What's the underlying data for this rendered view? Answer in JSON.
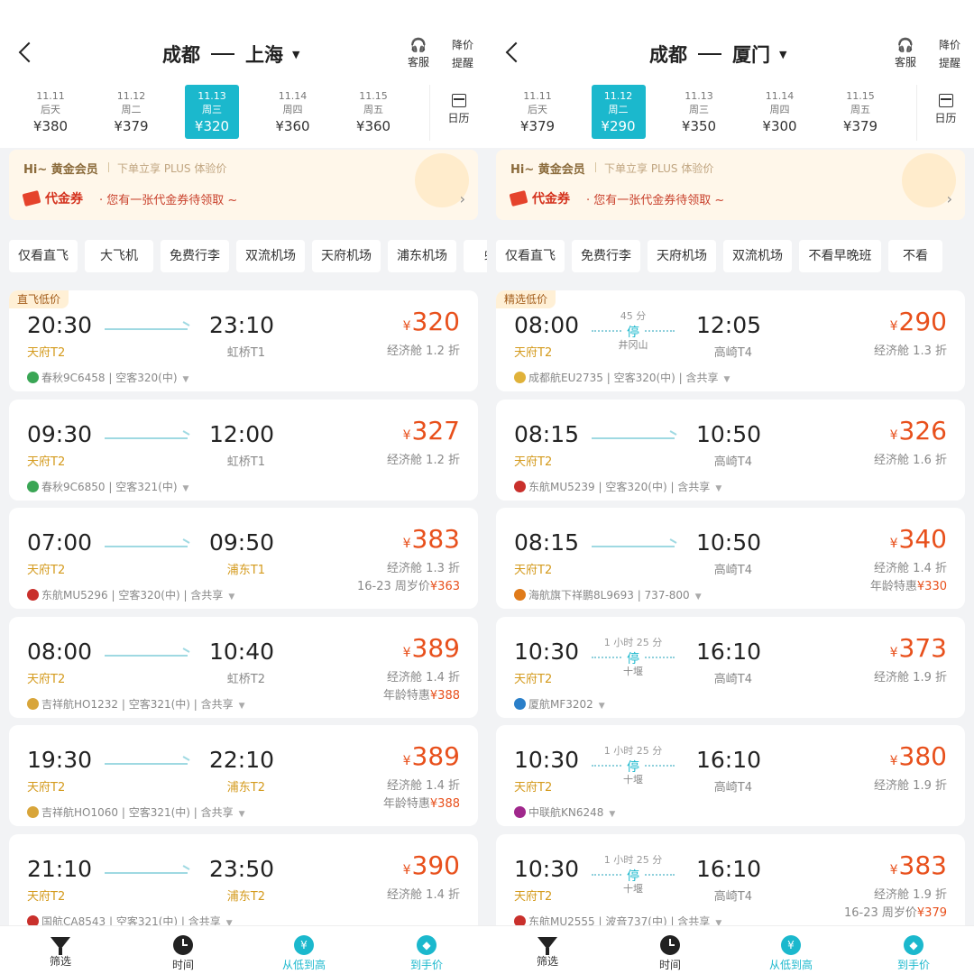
{
  "left": {
    "route": {
      "from": "成都",
      "to": "上海"
    },
    "header_btns": {
      "service": "客服",
      "alert_1": "降价",
      "alert_2": "提醒"
    },
    "dates": [
      {
        "date": "11.11",
        "day": "后天",
        "price": "¥380",
        "selected": false
      },
      {
        "date": "11.12",
        "day": "周二",
        "price": "¥379",
        "selected": false
      },
      {
        "date": "11.13",
        "day": "周三",
        "price": "¥320",
        "selected": true
      },
      {
        "date": "11.14",
        "day": "周四",
        "price": "¥360",
        "selected": false
      },
      {
        "date": "11.15",
        "day": "周五",
        "price": "¥360",
        "selected": false
      }
    ],
    "calendar": "日历",
    "promo": {
      "hi": "Hi~ 黄金会员",
      "sub": "下单立享 PLUS 体验价",
      "coupon_title": "代金券",
      "coupon_text": "· 您有一张代金券待领取 ~"
    },
    "chips": [
      "仅看直飞",
      "大飞机",
      "免费行李",
      "双流机场",
      "天府机场",
      "浦东机场",
      "虹"
    ],
    "flights": [
      {
        "tag": "直飞低价",
        "dep": "20:30",
        "dep_airport": "天府T2",
        "arr": "23:10",
        "arr_airport": "虹桥T1",
        "arr_hl": false,
        "price": "320",
        "cabin": "经济舱 1.2 折",
        "extra_label": "",
        "extra_value": "",
        "airline": "春秋9C6458",
        "meta": " | 空客320(中)",
        "logo_color": "#3aa655"
      },
      {
        "tag": "",
        "dep": "09:30",
        "dep_airport": "天府T2",
        "arr": "12:00",
        "arr_airport": "虹桥T1",
        "arr_hl": false,
        "price": "327",
        "cabin": "经济舱 1.2 折",
        "extra_label": "",
        "extra_value": "",
        "airline": "春秋9C6850",
        "meta": " | 空客321(中)",
        "logo_color": "#3aa655"
      },
      {
        "tag": "",
        "dep": "07:00",
        "dep_airport": "天府T2",
        "arr": "09:50",
        "arr_airport": "浦东T1",
        "arr_hl": true,
        "price": "383",
        "cabin": "经济舱 1.3 折",
        "extra_label": "16-23 周岁价",
        "extra_value": "¥363",
        "airline": "东航MU5296",
        "meta": " | 空客320(中) | 含共享",
        "logo_color": "#c9302c"
      },
      {
        "tag": "",
        "dep": "08:00",
        "dep_airport": "天府T2",
        "arr": "10:40",
        "arr_airport": "虹桥T2",
        "arr_hl": false,
        "price": "389",
        "cabin": "经济舱 1.4 折",
        "extra_label": "年龄特惠",
        "extra_value": "¥388",
        "airline": "吉祥航HO1232",
        "meta": " | 空客321(中) | 含共享",
        "logo_color": "#d8a53a"
      },
      {
        "tag": "",
        "dep": "19:30",
        "dep_airport": "天府T2",
        "arr": "22:10",
        "arr_airport": "浦东T2",
        "arr_hl": true,
        "price": "389",
        "cabin": "经济舱 1.4 折",
        "extra_label": "年龄特惠",
        "extra_value": "¥388",
        "airline": "吉祥航HO1060",
        "meta": " | 空客321(中) | 含共享",
        "logo_color": "#d8a53a"
      },
      {
        "tag": "",
        "dep": "21:10",
        "dep_airport": "天府T2",
        "arr": "23:50",
        "arr_airport": "浦东T2",
        "arr_hl": true,
        "price": "390",
        "cabin": "经济舱 1.4 折",
        "extra_label": "",
        "extra_value": "",
        "airline": "国航CA8543",
        "meta": " | 空客321(中) | 含共享",
        "logo_color": "#c9302c"
      }
    ]
  },
  "right": {
    "route": {
      "from": "成都",
      "to": "厦门"
    },
    "header_btns": {
      "service": "客服",
      "alert_1": "降价",
      "alert_2": "提醒"
    },
    "dates": [
      {
        "date": "11.11",
        "day": "后天",
        "price": "¥379",
        "selected": false
      },
      {
        "date": "11.12",
        "day": "周二",
        "price": "¥290",
        "selected": true
      },
      {
        "date": "11.13",
        "day": "周三",
        "price": "¥350",
        "selected": false
      },
      {
        "date": "11.14",
        "day": "周四",
        "price": "¥300",
        "selected": false
      },
      {
        "date": "11.15",
        "day": "周五",
        "price": "¥379",
        "selected": false
      }
    ],
    "calendar": "日历",
    "promo": {
      "hi": "Hi~ 黄金会员",
      "sub": "下单立享 PLUS 体验价",
      "coupon_title": "代金券",
      "coupon_text": "· 您有一张代金券待领取 ~"
    },
    "chips": [
      "仅看直飞",
      "免费行李",
      "天府机场",
      "双流机场",
      "不看早晚班",
      "不看"
    ],
    "flights": [
      {
        "tag": "精选低价",
        "dep": "08:00",
        "dep_airport": "天府T2",
        "arr": "12:05",
        "arr_airport": "高崎T4",
        "arr_hl": false,
        "stop": true,
        "stop_duration": "45 分",
        "stop_word": "停",
        "stop_city": "井冈山",
        "price": "290",
        "cabin": "经济舱 1.3 折",
        "extra_label": "",
        "extra_value": "",
        "airline": "成都航EU2735",
        "meta": " | 空客320(中) | 含共享",
        "logo_color": "#e0b23a"
      },
      {
        "tag": "",
        "dep": "08:15",
        "dep_airport": "天府T2",
        "arr": "10:50",
        "arr_airport": "高崎T4",
        "arr_hl": false,
        "stop": false,
        "price": "326",
        "cabin": "经济舱 1.6 折",
        "extra_label": "",
        "extra_value": "",
        "airline": "东航MU5239",
        "meta": " | 空客320(中) | 含共享",
        "logo_color": "#c9302c"
      },
      {
        "tag": "",
        "dep": "08:15",
        "dep_airport": "天府T2",
        "arr": "10:50",
        "arr_airport": "高崎T4",
        "arr_hl": false,
        "stop": false,
        "price": "340",
        "cabin": "经济舱 1.4 折",
        "extra_label": "年龄特惠",
        "extra_value": "¥330",
        "airline": "海航旗下祥鹏8L9693",
        "meta": " | 737-800",
        "logo_color": "#e07b1a"
      },
      {
        "tag": "",
        "dep": "10:30",
        "dep_airport": "天府T2",
        "arr": "16:10",
        "arr_airport": "高崎T4",
        "arr_hl": false,
        "stop": true,
        "stop_duration": "1 小时 25 分",
        "stop_word": "停",
        "stop_city": "十堰",
        "price": "373",
        "cabin": "经济舱 1.9 折",
        "extra_label": "",
        "extra_value": "",
        "airline": "厦航MF3202",
        "meta": "",
        "logo_color": "#2a7fc9"
      },
      {
        "tag": "",
        "dep": "10:30",
        "dep_airport": "天府T2",
        "arr": "16:10",
        "arr_airport": "高崎T4",
        "arr_hl": false,
        "stop": true,
        "stop_duration": "1 小时 25 分",
        "stop_word": "停",
        "stop_city": "十堰",
        "price": "380",
        "cabin": "经济舱 1.9 折",
        "extra_label": "",
        "extra_value": "",
        "airline": "中联航KN6248",
        "meta": "",
        "logo_color": "#a0288c"
      },
      {
        "tag": "",
        "dep": "10:30",
        "dep_airport": "天府T2",
        "arr": "16:10",
        "arr_airport": "高崎T4",
        "arr_hl": false,
        "stop": true,
        "stop_duration": "1 小时 25 分",
        "stop_word": "停",
        "stop_city": "十堰",
        "price": "383",
        "cabin": "经济舱 1.9 折",
        "extra_label": "16-23 周岁价",
        "extra_value": "¥379",
        "airline": "东航MU2555",
        "meta": " | 波音737(中) | 含共享",
        "logo_color": "#c9302c"
      }
    ]
  },
  "bottom_tabs": [
    {
      "label": "筛选",
      "icon": "filter-icon",
      "active": false
    },
    {
      "label": "时间",
      "icon": "clock-icon",
      "active": false
    },
    {
      "label": "从低到高",
      "icon": "yuan-icon",
      "active": true
    },
    {
      "label": "到手价",
      "icon": "tag-icon",
      "active": true
    }
  ],
  "colors": {
    "accent": "#1bb8cd",
    "price": "#e8501c",
    "airport_highlight": "#d49a1c"
  }
}
